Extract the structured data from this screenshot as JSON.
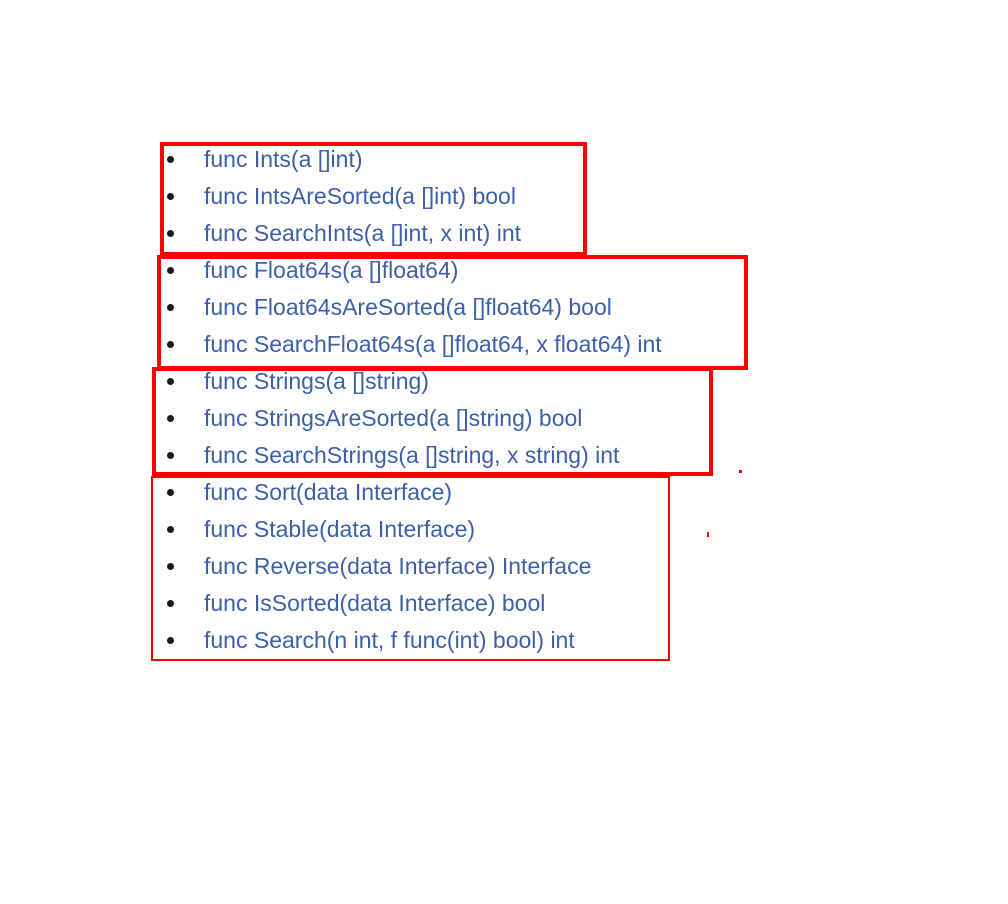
{
  "colors": {
    "link": "#3c5fa8",
    "highlight_border": "#ff0000",
    "bullet": "#1a1a1a",
    "background": "#ffffff"
  },
  "functions": [
    {
      "label": "func Ints(a []int)"
    },
    {
      "label": "func IntsAreSorted(a []int) bool"
    },
    {
      "label": "func SearchInts(a []int, x int) int"
    },
    {
      "label": "func Float64s(a []float64)"
    },
    {
      "label": "func Float64sAreSorted(a []float64) bool"
    },
    {
      "label": "func SearchFloat64s(a []float64, x float64) int"
    },
    {
      "label": "func Strings(a []string)"
    },
    {
      "label": "func StringsAreSorted(a []string) bool"
    },
    {
      "label": "func SearchStrings(a []string, x string) int"
    },
    {
      "label": "func Sort(data Interface)"
    },
    {
      "label": "func Stable(data Interface)"
    },
    {
      "label": "func Reverse(data Interface) Interface"
    },
    {
      "label": "func IsSorted(data Interface) bool"
    },
    {
      "label": "func Search(n int, f func(int) bool) int"
    }
  ]
}
